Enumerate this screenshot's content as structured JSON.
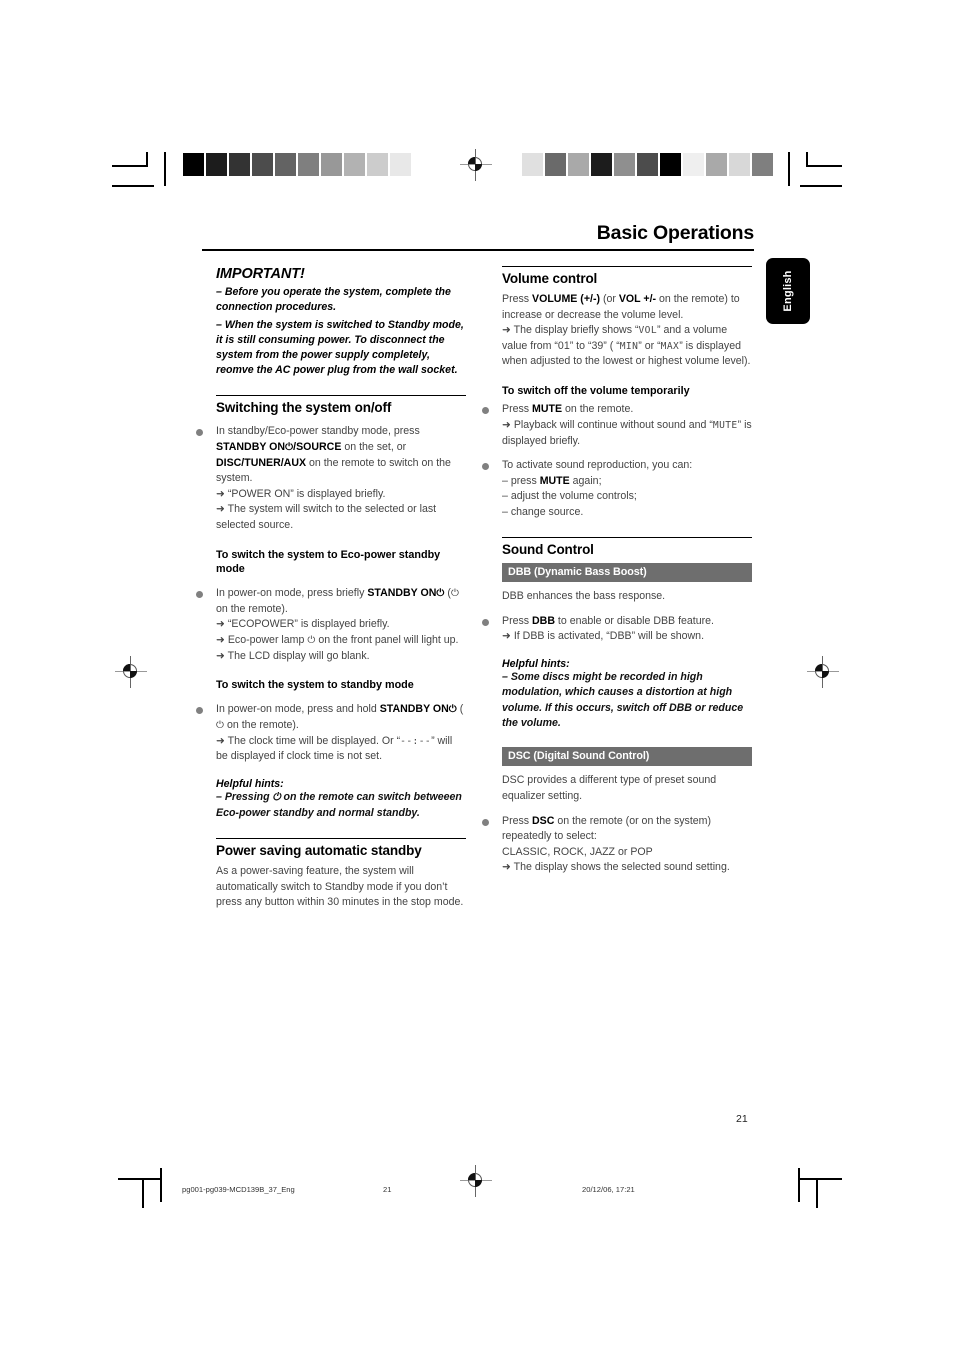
{
  "page": {
    "title": "Basic Operations",
    "language_tab": "English",
    "page_number": "21"
  },
  "footer": {
    "filename": "pg001-pg039-MCD139B_37_Eng",
    "page": "21",
    "timestamp": "20/12/06, 17:21"
  },
  "calibration": {
    "left_bar": [
      "#000000",
      "#1c1c1c",
      "#333333",
      "#4c4c4c",
      "#636363",
      "#7f7f7f",
      "#989898",
      "#b2b2b2",
      "#cccccc",
      "#e8e8e8",
      "#ffffff"
    ],
    "right_bar": [
      "#e0e0e0",
      "#6a6a6a",
      "#a9a9a9",
      "#1c1c1c",
      "#8f8f8f",
      "#4c4c4c",
      "#000000",
      "#efefef",
      "#a9a9a9",
      "#d8d8d8",
      "#7f7f7f"
    ]
  },
  "left_column": {
    "important": {
      "heading": "IMPORTANT!",
      "lines": [
        "–  Before you operate the system, complete the connection procedures.",
        "–  When the system is switched to Standby mode,  it is still consuming power. To disconnect the system from the power supply completely, reomve the AC power plug from the wall socket."
      ]
    },
    "switching": {
      "heading": "Switching the system on/off",
      "item1_line1": "In standby/Eco-power standby mode, press",
      "item1_b1": "STANDBY ON",
      "item1_pwr": "⏻",
      "item1_b1b": "/SOURCE",
      "item1_mid": " on the set, or",
      "item1_b2": "DISC/TUNER/AUX",
      "item1_tail": " on the remote to switch on the system.",
      "arrow1": "“POWER ON” is displayed briefly.",
      "arrow2": "The system will switch to the selected or last selected source."
    },
    "ecopower": {
      "heading": "To switch the system to Eco-power standby mode",
      "lead": "In power-on mode, press briefly ",
      "bold": "STANDBY ON",
      "pwr": "⏻",
      "paren_open": " (",
      "paren_pwr": "⏻",
      "paren_close": " on the remote).",
      "arrow1": "“ECOPOWER” is displayed briefly.",
      "arrow2_a": "Eco-power lamp ",
      "arrow2_pwr": "⏻",
      "arrow2_b": " on the front panel will light up.",
      "arrow3": "The LCD display will go blank."
    },
    "standby": {
      "heading": "To switch the system to standby mode",
      "lead": "In power-on mode, press and hold ",
      "bold": "STANDBY ON",
      "pwr": "⏻",
      "paren_open": " (",
      "paren_pwr": "⏻",
      "paren_close": " on the remote).",
      "arrow1_a": "The clock time will be displayed. Or “",
      "arrow1_lcd": "--:--",
      "arrow1_b": "” will be displayed if clock time is not set."
    },
    "hints1": {
      "heading": "Helpful hints:",
      "text_a": "–  Pressing ",
      "pwr": "⏻",
      "text_b": " on the remote can switch betweeen Eco-power standby and normal standby."
    },
    "power_saving": {
      "heading": "Power saving automatic standby",
      "body": "As a power-saving feature, the system will automatically switch to Standby mode if you don’t press any button within 30 minutes in the stop mode."
    }
  },
  "right_column": {
    "volume": {
      "heading": "Volume control",
      "lead": "Press ",
      "b1": "VOLUME (+/-)",
      "mid1": " (or ",
      "b2": "VOL +/-",
      "mid2": " on the remote) to increase or decrease the volume level.",
      "arrow_a": "The display briefly shows “",
      "lcd_vol": "VOL",
      "arrow_b": "” and a volume value from “01” to “39” ( “",
      "lcd_min": "MIN",
      "arrow_c": "” or “",
      "lcd_max": "MAX",
      "arrow_d": "” is displayed when adjusted to the lowest or highest volume level)."
    },
    "mute": {
      "heading": "To switch off the volume temporarily",
      "item1_lead": "Press ",
      "item1_b": "MUTE",
      "item1_tail": " on the remote.",
      "arrow1_a": "Playback will continue without sound and “",
      "arrow1_lcd": "MUTE",
      "arrow1_b": "” is displayed briefly.",
      "item2": "To activate sound reproduction, you can:",
      "sub1_a": "– press ",
      "sub1_b": "MUTE",
      "sub1_c": " again;",
      "sub2": "– adjust the volume controls;",
      "sub3": "– change source."
    },
    "sound_control": {
      "heading": "Sound Control",
      "dbb": {
        "bar": "DBB (Dynamic Bass Boost)",
        "desc": "DBB enhances the bass response.",
        "item_lead": "Press ",
        "item_b": "DBB",
        "item_tail": " to enable or disable DBB feature.",
        "arrow": "If DBB is activated, “DBB” will be shown."
      },
      "hints": {
        "heading": "Helpful hints:",
        "text": "–  Some discs might be recorded in high modulation, which causes a distortion at high volume. If this occurs, switch off DBB or reduce the volume."
      },
      "dsc": {
        "bar": "DSC (Digital Sound Control)",
        "desc": "DSC provides a different type of preset sound equalizer setting.",
        "item_lead": "Press ",
        "item_b": "DSC",
        "item_tail": " on the remote (or on the system) repeatedly to select:",
        "options": "CLASSIC, ROCK, JAZZ or POP",
        "arrow": "The display shows the selected sound setting."
      }
    }
  }
}
